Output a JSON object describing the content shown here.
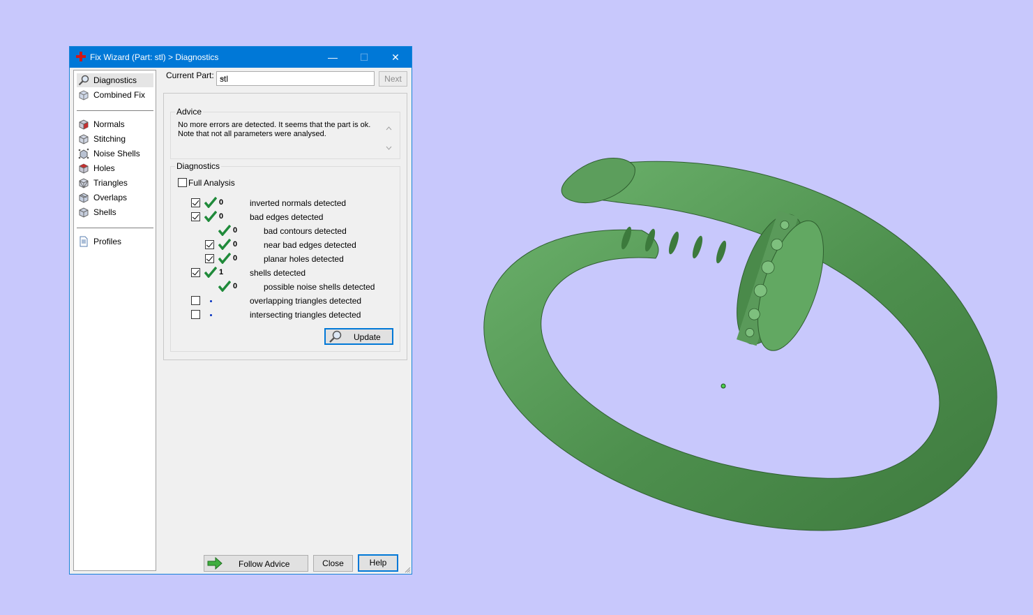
{
  "window": {
    "title": "Fix Wizard (Part: stl) > Diagnostics",
    "controls": {
      "minimize": "—",
      "maximize": "☐",
      "close": "✕"
    }
  },
  "sidebar": {
    "top_items": [
      {
        "label": "Diagnostics",
        "icon": "magnifier-icon",
        "selected": true
      },
      {
        "label": "Combined Fix",
        "icon": "cube-icon"
      }
    ],
    "fix_items": [
      {
        "label": "Normals",
        "icon": "normals-cube-icon"
      },
      {
        "label": "Stitching",
        "icon": "stitching-cube-icon"
      },
      {
        "label": "Noise Shells",
        "icon": "noise-shells-icon"
      },
      {
        "label": "Holes",
        "icon": "holes-cube-icon"
      },
      {
        "label": "Triangles",
        "icon": "triangles-cube-icon"
      },
      {
        "label": "Overlaps",
        "icon": "overlaps-cube-icon"
      },
      {
        "label": "Shells",
        "icon": "shells-cube-icon"
      }
    ],
    "bottom_items": [
      {
        "label": "Profiles",
        "icon": "document-icon"
      }
    ]
  },
  "current_part": {
    "label": "Current Part:",
    "value": "stl",
    "next_label": "Next"
  },
  "advice": {
    "title": "Advice",
    "line1": "No more errors are detected. It seems that the part is ok.",
    "line2": "Note that not all parameters were analysed."
  },
  "diagnostics": {
    "title": "Diagnostics",
    "full_analysis_label": "Full Analysis",
    "full_analysis_checked": false,
    "rows": [
      {
        "label": "inverted normals detected",
        "count": "0",
        "checked": true,
        "status": "ok",
        "indent": 0
      },
      {
        "label": "bad edges detected",
        "count": "0",
        "checked": true,
        "status": "ok",
        "indent": 0
      },
      {
        "label": "bad contours detected",
        "count": "0",
        "checked": null,
        "status": "ok",
        "indent": 1
      },
      {
        "label": "near bad edges detected",
        "count": "0",
        "checked": true,
        "status": "ok",
        "indent": 1
      },
      {
        "label": "planar holes detected",
        "count": "0",
        "checked": true,
        "status": "ok",
        "indent": 1
      },
      {
        "label": "shells detected",
        "count": "1",
        "checked": true,
        "status": "ok",
        "indent": 0
      },
      {
        "label": "possible noise shells detected",
        "count": "0",
        "checked": null,
        "status": "ok",
        "indent": 1
      },
      {
        "label": "overlapping triangles detected",
        "count": "",
        "checked": false,
        "status": "pending",
        "indent": 0
      },
      {
        "label": "intersecting triangles detected",
        "count": "",
        "checked": false,
        "status": "pending",
        "indent": 0
      }
    ],
    "update_label": "Update"
  },
  "footer": {
    "follow_advice": "Follow Advice",
    "close": "Close",
    "help": "Help"
  },
  "colors": {
    "background": "#c8c8fc",
    "titlebar": "#0078d7",
    "model_green": "#5fa05f",
    "check_green": "#1f8a3a"
  }
}
